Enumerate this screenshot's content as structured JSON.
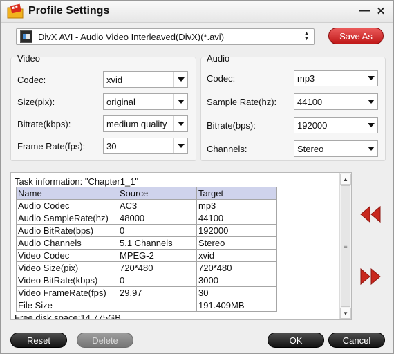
{
  "window": {
    "title": "Profile Settings"
  },
  "profile": {
    "selected": "DivX AVI - Audio Video Interleaved(DivX)(*.avi)",
    "save_as_label": "Save As"
  },
  "video": {
    "title": "Video",
    "codec_label": "Codec:",
    "codec_value": "xvid",
    "size_label": "Size(pix):",
    "size_value": "original",
    "bitrate_label": "Bitrate(kbps):",
    "bitrate_value": "medium quality",
    "framerate_label": "Frame Rate(fps):",
    "framerate_value": "30"
  },
  "audio": {
    "title": "Audio",
    "codec_label": "Codec:",
    "codec_value": "mp3",
    "samplerate_label": "Sample Rate(hz):",
    "samplerate_value": "44100",
    "bitrate_label": "Bitrate(bps):",
    "bitrate_value": "192000",
    "channels_label": "Channels:",
    "channels_value": "Stereo"
  },
  "task": {
    "heading": "Task information: \"Chapter1_1\"",
    "columns": [
      "Name",
      "Source",
      "Target"
    ],
    "rows": [
      [
        "Audio Codec",
        "AC3",
        "mp3"
      ],
      [
        "Audio SampleRate(hz)",
        "48000",
        "44100"
      ],
      [
        "Audio BitRate(bps)",
        "0",
        "192000"
      ],
      [
        "Audio Channels",
        "5.1 Channels",
        "Stereo"
      ],
      [
        "Video Codec",
        "MPEG-2",
        "xvid"
      ],
      [
        "Video Size(pix)",
        "720*480",
        "720*480"
      ],
      [
        "Video BitRate(kbps)",
        "0",
        "3000"
      ],
      [
        "Video FrameRate(fps)",
        "29.97",
        "30"
      ],
      [
        "File Size",
        "",
        "191.409MB"
      ]
    ],
    "free_disk_space": "Free disk space:14.775GB"
  },
  "buttons": {
    "reset": "Reset",
    "delete": "Delete",
    "ok": "OK",
    "cancel": "Cancel"
  },
  "icons": {
    "app": "film-folder-icon",
    "minimize": "minimize-icon",
    "close": "close-icon",
    "profile": "divx-format-icon",
    "prev": "double-chevron-left-icon",
    "next": "double-chevron-right-icon"
  },
  "colors": {
    "accent_red": "#c01818",
    "table_header": "#cfd3ec",
    "button_dark": "#121212"
  }
}
